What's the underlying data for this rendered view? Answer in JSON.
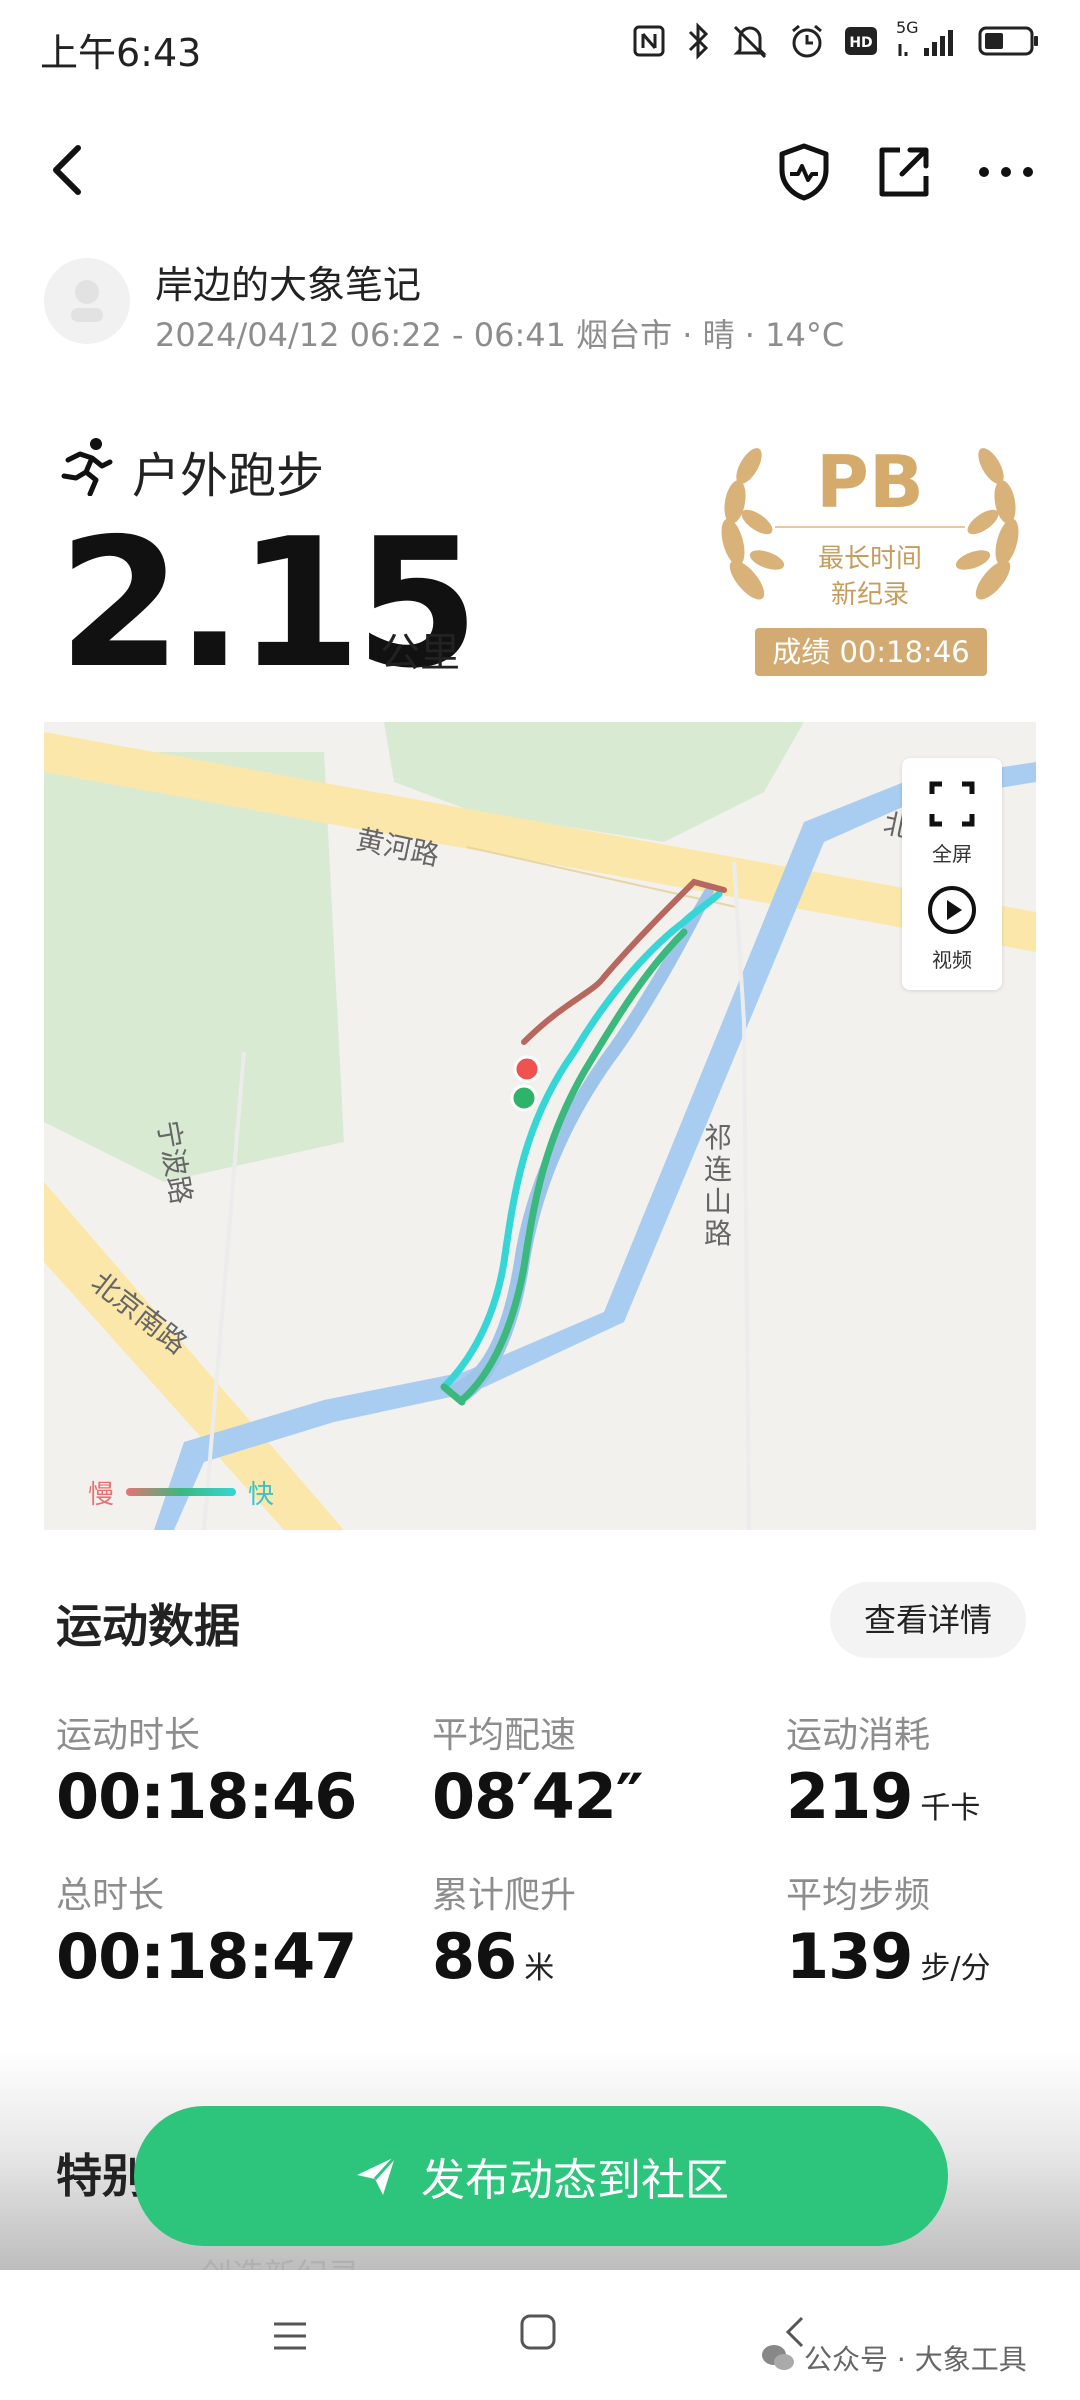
{
  "status_bar": {
    "time": "上午6:43",
    "network": "5G"
  },
  "header": {
    "back_icon": "back-arrow-icon",
    "icons": [
      "shield-icon",
      "share-icon",
      "more-icon"
    ]
  },
  "user": {
    "name": "岸边的大象笔记",
    "meta": "2024/04/12 06:22 - 06:41 烟台市 · 晴 · 14°C"
  },
  "sport": {
    "name": "户外跑步",
    "distance": "2.15",
    "unit": "公里"
  },
  "badge": {
    "title": "PB",
    "line1": "最长时间",
    "line2": "新纪录",
    "score": "成绩 00:18:46",
    "color": "#d5ab6b"
  },
  "map": {
    "roads": {
      "huanghe": "黄河路",
      "ningbo": "宁波路",
      "beijing_south": "北京南路",
      "qilianshan": "祁连山路",
      "partial": "北"
    },
    "controls": {
      "fullscreen": "全屏",
      "video": "视频"
    },
    "legend": {
      "slow": "慢",
      "fast": "快"
    }
  },
  "stats": {
    "title": "运动数据",
    "detail_button": "查看详情",
    "items": [
      {
        "label": "运动时长",
        "value": "00:18:46",
        "unit": ""
      },
      {
        "label": "平均配速",
        "value": "08′42″",
        "unit": ""
      },
      {
        "label": "运动消耗",
        "value": "219",
        "unit": "千卡"
      },
      {
        "label": "总时长",
        "value": "00:18:47",
        "unit": ""
      },
      {
        "label": "累计爬升",
        "value": "86",
        "unit": "米"
      },
      {
        "label": "平均步频",
        "value": "139",
        "unit": "步/分"
      }
    ]
  },
  "special": {
    "label": "特别",
    "peek": "创造新纪录"
  },
  "publish_button": "发布动态到社区",
  "watermark": "公众号 · 大象工具",
  "colors": {
    "accent": "#2dc47c",
    "gold": "#d3ab72"
  }
}
